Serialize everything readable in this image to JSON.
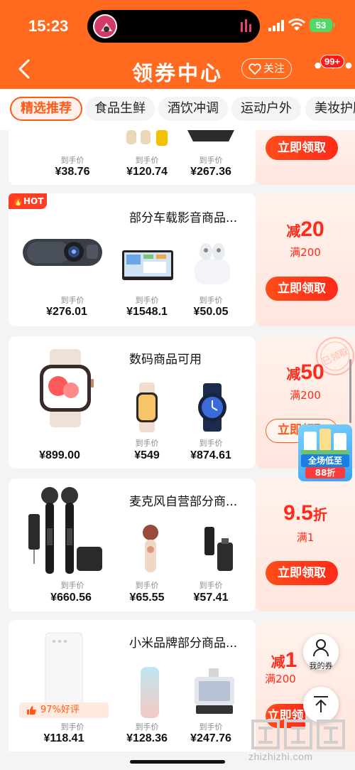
{
  "status_bar": {
    "time": "15:23",
    "battery": "53"
  },
  "header": {
    "title": "领券中心",
    "follow_label": "关注",
    "badge": "99+"
  },
  "tabs": [
    {
      "label": "精选推荐",
      "active": true
    },
    {
      "label": "食品生鲜"
    },
    {
      "label": "酒饮冲调"
    },
    {
      "label": "运动户外"
    },
    {
      "label": "美妆护肤"
    }
  ],
  "cards": [
    {
      "name": "",
      "products": [
        {
          "label": "到手价",
          "price": "¥38.76"
        },
        {
          "label": "到手价",
          "price": "¥120.74"
        },
        {
          "label": "到手价",
          "price": "¥267.36"
        }
      ],
      "coupon": {
        "claim_label": "立即领取"
      }
    },
    {
      "hot": "HOT",
      "name": "部分车载影音商品...",
      "products": [
        {
          "label": "到手价",
          "price": "¥276.01"
        },
        {
          "label": "到手价",
          "price": "¥1548.1"
        },
        {
          "label": "到手价",
          "price": "¥50.05"
        }
      ],
      "coupon": {
        "prefix": "减",
        "amount": "20",
        "condition": "满200",
        "claim_label": "立即领取"
      }
    },
    {
      "name": "数码商品可用",
      "products": [
        {
          "label": "",
          "price": "¥899.00"
        },
        {
          "label": "到手价",
          "price": "¥549"
        },
        {
          "label": "到手价",
          "price": "¥874.61"
        }
      ],
      "coupon": {
        "prefix": "减",
        "amount": "50",
        "condition": "满200",
        "claim_label": "立即领取",
        "stamp": "已领取"
      }
    },
    {
      "name": "麦克风自营部分商...",
      "products": [
        {
          "label": "到手价",
          "price": "¥660.56"
        },
        {
          "label": "到手价",
          "price": "¥65.55"
        },
        {
          "label": "到手价",
          "price": "¥57.41"
        }
      ],
      "coupon": {
        "amount": "9.5",
        "suffix": "折",
        "condition": "满1",
        "claim_label": "立即领取"
      }
    },
    {
      "name": "小米品牌部分商品...",
      "rating": "97%好评",
      "products": [
        {
          "label": "到手价",
          "price": "¥118.41"
        },
        {
          "label": "到手价",
          "price": "¥128.36"
        },
        {
          "label": "到手价",
          "price": "¥247.76"
        }
      ],
      "coupon": {
        "prefix": "减",
        "amount": "1",
        "condition": "满200",
        "claim_label": "立即领取"
      }
    }
  ],
  "floating": {
    "my_coupons_label": "我的券",
    "promo_line1": "全场低至",
    "promo_line2": "88折"
  },
  "watermark": {
    "url": "zhizhizhi.com"
  },
  "colors": {
    "brand": "#ff6a1f",
    "accent": "#ff2a1a"
  }
}
